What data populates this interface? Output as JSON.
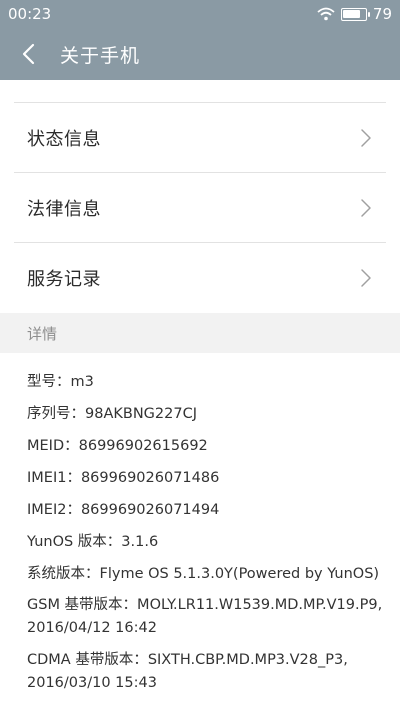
{
  "status_bar": {
    "time": "00:23",
    "battery_level": "79",
    "battery_fraction": 0.79
  },
  "header": {
    "title": "关于手机",
    "back_icon": "chevron-left-icon",
    "background_color": "#8a9aa4"
  },
  "menu": {
    "items": [
      {
        "label": "状态信息",
        "icon": "chevron-right-icon"
      },
      {
        "label": "法律信息",
        "icon": "chevron-right-icon"
      },
      {
        "label": "服务记录",
        "icon": "chevron-right-icon"
      }
    ]
  },
  "details": {
    "header": "详情",
    "rows": [
      {
        "text": "型号：m3"
      },
      {
        "text": "序列号：98AKBNG227CJ"
      },
      {
        "text": "MEID：86996902615692"
      },
      {
        "text": "IMEI1：869969026071486"
      },
      {
        "text": "IMEI2：869969026071494"
      },
      {
        "text": "YunOS 版本：3.1.6"
      },
      {
        "text": "系统版本：Flyme OS 5.1.3.0Y(Powered by YunOS)"
      },
      {
        "text": "GSM 基带版本：MOLY.LR11.W1539.MD.MP.V19.P9, 2016/04/12 16:42"
      },
      {
        "text": "CDMA 基带版本：SIXTH.CBP.MD.MP3.V28_P3, 2016/03/10 15:43"
      }
    ]
  }
}
